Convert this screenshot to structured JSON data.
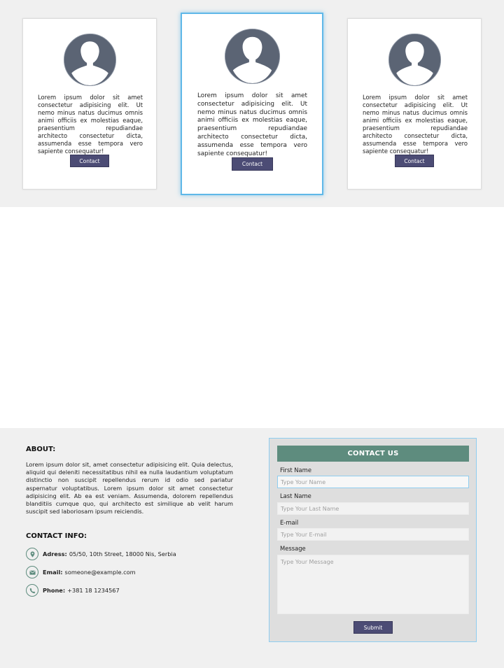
{
  "cards": [
    {
      "avatar_icon": "user-silhouette-icon",
      "text": "Lorem ipsum dolor sit amet consectetur adipisicing elit. Ut nemo minus natus ducimus omnis animi officiis ex molestias eaque, praesentium repudiandae architecto consectetur dicta, assumenda esse tempora vero sapiente consequatur!",
      "button_label": "Contact"
    },
    {
      "avatar_icon": "user-silhouette-icon",
      "text": "Lorem ipsum dolor sit amet consectetur adipisicing elit. Ut nemo minus natus ducimus omnis animi officiis ex molestias eaque, praesentium repudiandae architecto consectetur dicta, assumenda esse tempora vero sapiente consequatur!",
      "button_label": "Contact"
    },
    {
      "avatar_icon": "user-silhouette-icon",
      "text": "Lorem ipsum dolor sit amet consectetur adipisicing elit. Ut nemo minus natus ducimus omnis animi officiis ex molestias eaque, praesentium repudiandae architecto consectetur dicta, assumenda esse tempora vero sapiente consequatur!",
      "button_label": "Contact"
    }
  ],
  "about": {
    "title": "ABOUT:",
    "text": "Lorem ipsum dolor sit, amet consectetur adipisicing elit. Quia delectus, aliquid qui deleniti necessitatibus nihil ea nulla laudantium voluptatum distinctio non suscipit repellendus rerum id odio sed pariatur aspernatur voluptatibus. Lorem ipsum dolor sit amet consectetur adipisicing elit. Ab ea est veniam. Assumenda, dolorem repellendus blanditiis cumque quo, qui architecto est similique ab velit harum suscipit sed laboriosam ipsum reiciendis."
  },
  "contact_info": {
    "title": "CONTACT INFO:",
    "items": [
      {
        "icon": "location-pin-icon",
        "label": "Adress:",
        "value": "05/50, 10th Street, 18000 Nis, Serbia"
      },
      {
        "icon": "envelope-icon",
        "label": "Email:",
        "value": "someone@example.com"
      },
      {
        "icon": "phone-icon",
        "label": "Phone:",
        "value": "+381 18 1234567"
      }
    ]
  },
  "contact_form": {
    "title": "CONTACT US",
    "first_name": {
      "label": "First Name",
      "placeholder": "Type Your Name",
      "value": ""
    },
    "last_name": {
      "label": "Last Name",
      "placeholder": "Type Your Last Name",
      "value": ""
    },
    "email": {
      "label": "E-mail",
      "placeholder": "Type Your E-mail",
      "value": ""
    },
    "message": {
      "label": "Message",
      "placeholder": "Type Your Message",
      "value": ""
    },
    "submit_label": "Submit"
  },
  "colors": {
    "button": "#4c4c75",
    "accent_green": "#5e8c7e",
    "focus_blue": "#5fb8e8",
    "section_bg": "#f0f0f0",
    "avatar_bg": "#5b6474"
  }
}
